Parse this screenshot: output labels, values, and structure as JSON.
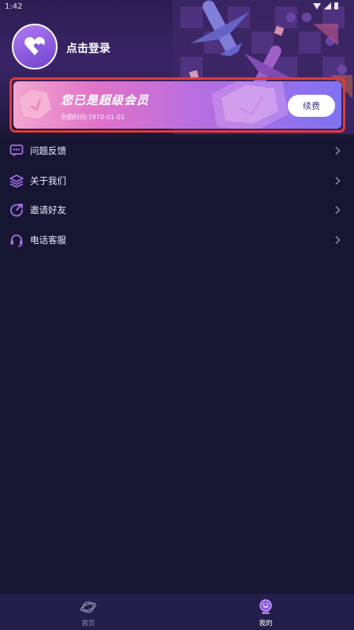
{
  "status_bar": {
    "time": "1:42"
  },
  "profile": {
    "login_text": "点击登录"
  },
  "vip_card": {
    "title": "您已是超级会员",
    "expiry": "到期时间:1970-01-01",
    "renew_label": "续费"
  },
  "menu": {
    "items": [
      {
        "label": "问题反馈",
        "icon": "feedback-icon"
      },
      {
        "label": "关于我们",
        "icon": "layers-icon"
      },
      {
        "label": "邀请好友",
        "icon": "share-icon"
      },
      {
        "label": "电话客服",
        "icon": "headset-icon"
      }
    ]
  },
  "tabbar": {
    "tabs": [
      {
        "label": "首页",
        "icon": "planet-icon",
        "active": false
      },
      {
        "label": "我的",
        "icon": "profile-icon",
        "active": true
      }
    ]
  },
  "colors": {
    "background": "#161632",
    "accent": "#a86ee8",
    "highlight_border": "#e23a3a"
  }
}
